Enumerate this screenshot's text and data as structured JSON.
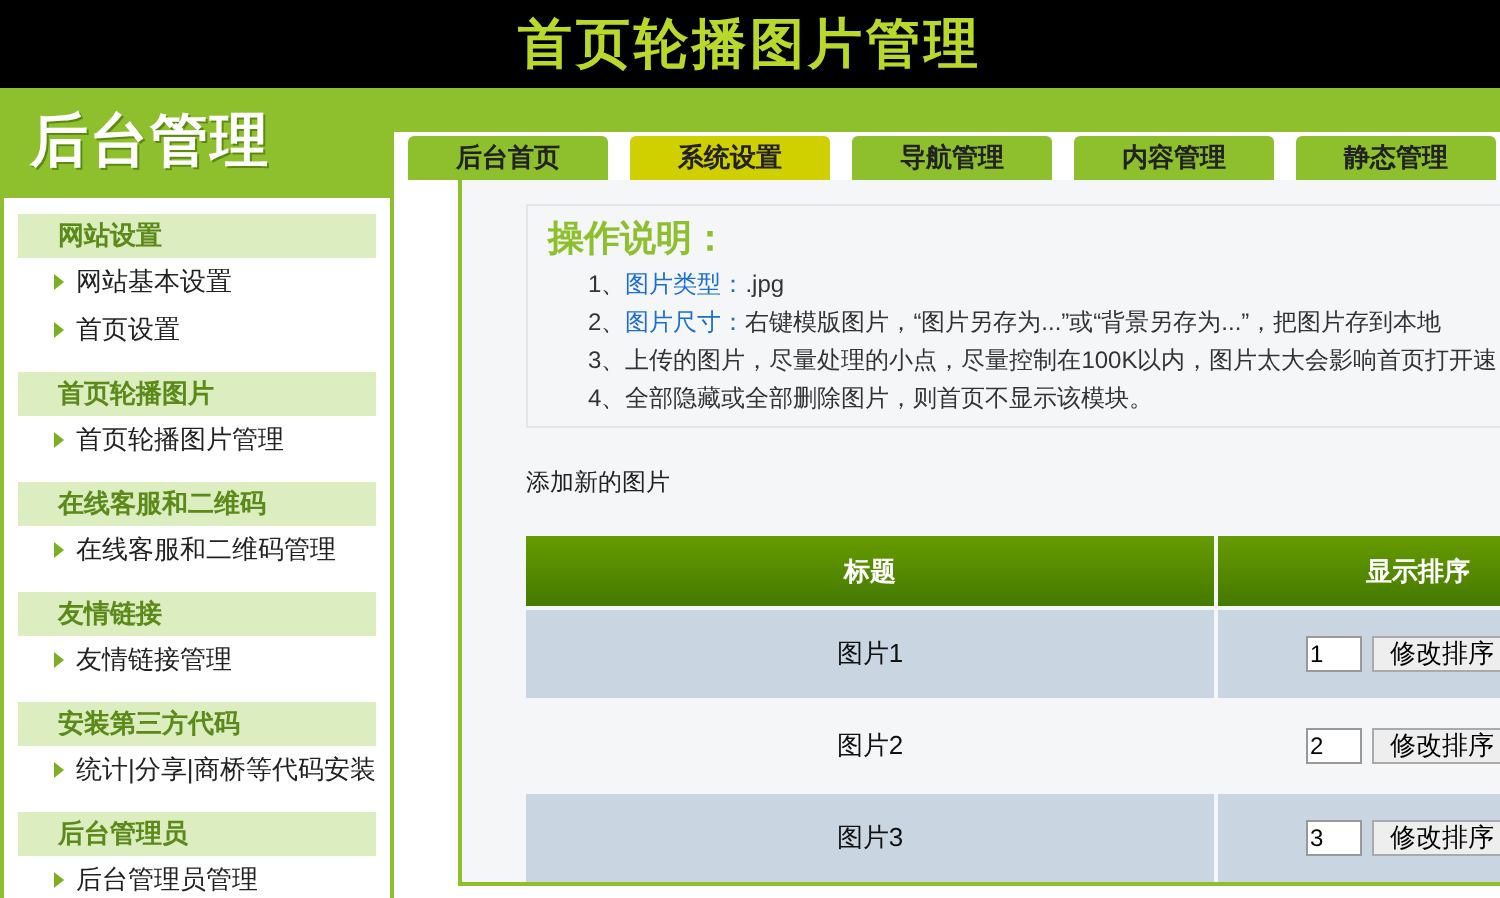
{
  "header": {
    "title": "首页轮播图片管理"
  },
  "sidebar": {
    "logo": "后台管理",
    "sections": [
      {
        "title": "网站设置",
        "items": [
          "网站基本设置",
          "首页设置"
        ]
      },
      {
        "title": "首页轮播图片",
        "items": [
          "首页轮播图片管理"
        ]
      },
      {
        "title": "在线客服和二维码",
        "items": [
          "在线客服和二维码管理"
        ]
      },
      {
        "title": "友情链接",
        "items": [
          "友情链接管理"
        ]
      },
      {
        "title": "安装第三方代码",
        "items": [
          "统计|分享|商桥等代码安装"
        ]
      },
      {
        "title": "后台管理员",
        "items": [
          "后台管理员管理"
        ]
      }
    ]
  },
  "tabs": [
    {
      "label": "后台首页",
      "selected": false
    },
    {
      "label": "系统设置",
      "selected": true
    },
    {
      "label": "导航管理",
      "selected": false
    },
    {
      "label": "内容管理",
      "selected": false
    },
    {
      "label": "静态管理",
      "selected": false
    }
  ],
  "instructions": {
    "heading": "操作说明：",
    "lines": [
      {
        "number": "1、",
        "link": "图片类型：",
        "text": ".jpg"
      },
      {
        "number": "2、",
        "link": "图片尺寸：",
        "text": "右键模版图片，“图片另存为...”或“背景另存为...”，把图片存到本地"
      },
      {
        "number": "3、",
        "text": "上传的图片，尽量处理的小点，尽量控制在100K以内，图片太大会影响首页打开速"
      },
      {
        "number": "4、",
        "text": "全部隐藏或全部删除图片，则首页不显示该模块。"
      }
    ]
  },
  "add_link": "添加新的图片",
  "table": {
    "columns": [
      "标题",
      "显示排序"
    ],
    "rows": [
      {
        "title": "图片1",
        "order": "1",
        "button": "修改排序"
      },
      {
        "title": "图片2",
        "order": "2",
        "button": "修改排序"
      },
      {
        "title": "图片3",
        "order": "3",
        "button": "修改排序"
      }
    ]
  }
}
